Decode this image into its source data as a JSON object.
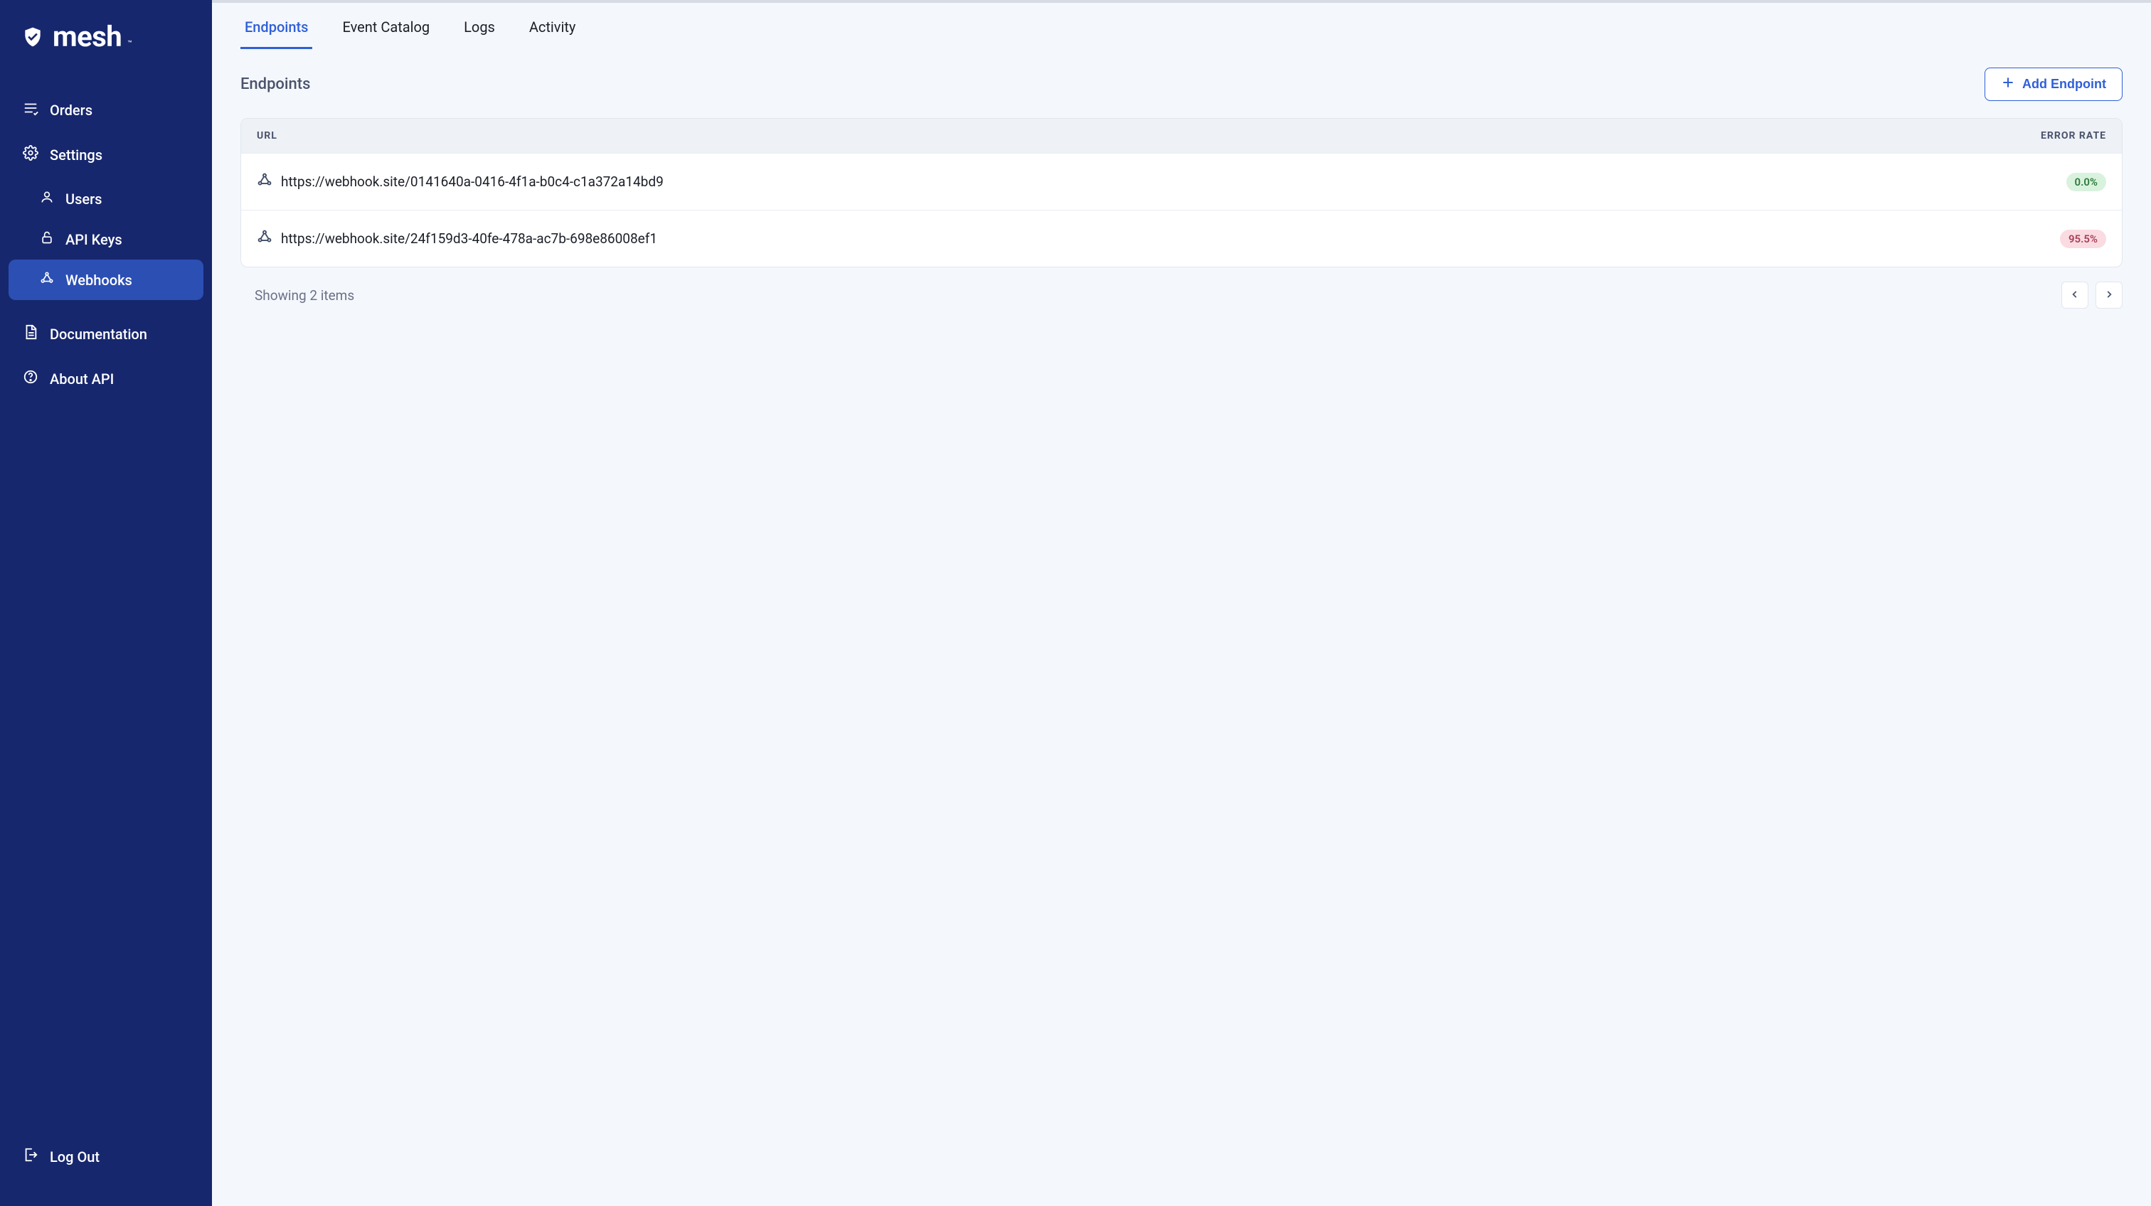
{
  "brand": {
    "name": "mesh"
  },
  "sidebar": {
    "items": [
      {
        "id": "orders",
        "label": "Orders",
        "icon": "list-icon",
        "active": false,
        "sub": false
      },
      {
        "id": "settings",
        "label": "Settings",
        "icon": "gear-icon",
        "active": false,
        "sub": false
      },
      {
        "id": "users",
        "label": "Users",
        "icon": "person-icon",
        "active": false,
        "sub": true
      },
      {
        "id": "apikeys",
        "label": "API Keys",
        "icon": "lock-open-icon",
        "active": false,
        "sub": true
      },
      {
        "id": "webhooks",
        "label": "Webhooks",
        "icon": "webhook-icon",
        "active": true,
        "sub": true
      },
      {
        "id": "docs",
        "label": "Documentation",
        "icon": "document-icon",
        "active": false,
        "sub": false
      },
      {
        "id": "about",
        "label": "About API",
        "icon": "help-icon",
        "active": false,
        "sub": false
      }
    ],
    "logout_label": "Log Out"
  },
  "tabs": [
    {
      "id": "endpoints",
      "label": "Endpoints",
      "active": true
    },
    {
      "id": "catalog",
      "label": "Event Catalog",
      "active": false
    },
    {
      "id": "logs",
      "label": "Logs",
      "active": false
    },
    {
      "id": "activity",
      "label": "Activity",
      "active": false
    }
  ],
  "page": {
    "title": "Endpoints",
    "add_button_label": "Add Endpoint"
  },
  "table": {
    "columns": {
      "url": "URL",
      "error_rate": "ERROR RATE"
    },
    "rows": [
      {
        "url": "https://webhook.site/0141640a-0416-4f1a-b0c4-c1a372a14bd9",
        "error_rate": "0.0%",
        "status": "ok"
      },
      {
        "url": "https://webhook.site/24f159d3-40fe-478a-ac7b-698e86008ef1",
        "error_rate": "95.5%",
        "status": "err"
      }
    ]
  },
  "footer": {
    "showing_text": "Showing 2 items"
  }
}
